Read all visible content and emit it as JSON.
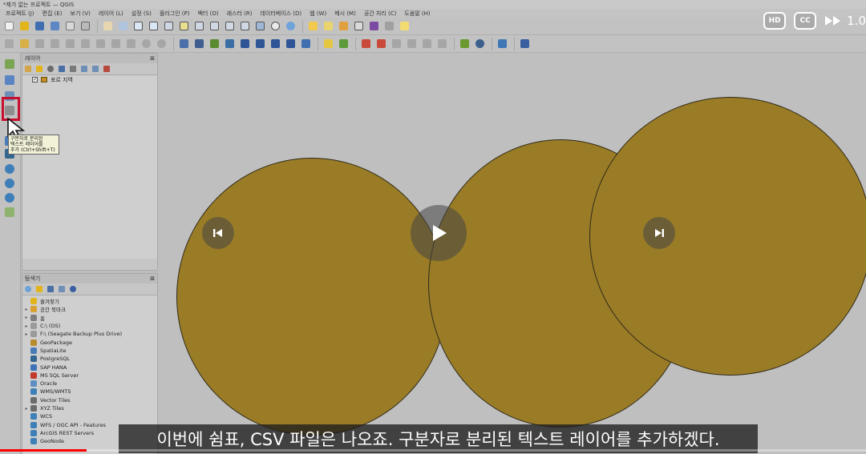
{
  "window": {
    "title": "*제가 없는 프로젝트 — QGIS"
  },
  "menu": [
    "프로젝트 (J)",
    "편집 (E)",
    "보기 (V)",
    "레이어 (L)",
    "설정 (S)",
    "플러그인 (P)",
    "벡터 (O)",
    "래스터 (R)",
    "데이터베이스 (D)",
    "웹 (W)",
    "메시 (M)",
    "공간 처리 (C)",
    "도움말 (H)"
  ],
  "layers_panel": {
    "title": "레이어",
    "layer_name": "포르 지역",
    "layer_checked": "✓",
    "layer_color": "#c48f26"
  },
  "browser_panel": {
    "title": "탐색기",
    "items": [
      {
        "label": "즐겨찾기",
        "expander": "",
        "icon_color": "#e3b51d"
      },
      {
        "label": "공간 북마크",
        "expander": "▸",
        "icon_color": "#d9a032"
      },
      {
        "label": "홈",
        "expander": "▸",
        "icon_color": "#7d7d7d"
      },
      {
        "label": "C:\\ (OS)",
        "expander": "▸",
        "icon_color": "#9a9a9a"
      },
      {
        "label": "F:\\ (Seagate Backup Plus Drive)",
        "expander": "▸",
        "icon_color": "#9a9a9a"
      },
      {
        "label": "GeoPackage",
        "expander": "",
        "icon_color": "#b88b2e"
      },
      {
        "label": "SpatiaLite",
        "expander": "",
        "icon_color": "#4a7bb7"
      },
      {
        "label": "PostgreSQL",
        "expander": "",
        "icon_color": "#336791"
      },
      {
        "label": "SAP HANA",
        "expander": "",
        "icon_color": "#3d72b8"
      },
      {
        "label": "MS SQL Server",
        "expander": "",
        "icon_color": "#c0392b"
      },
      {
        "label": "Oracle",
        "expander": "",
        "icon_color": "#5f8fc1"
      },
      {
        "label": "WMS/WMTS",
        "expander": "",
        "icon_color": "#3f7fb8"
      },
      {
        "label": "Vector Tiles",
        "expander": "",
        "icon_color": "#6b6b6b"
      },
      {
        "label": "XYZ Tiles",
        "expander": "▸",
        "icon_color": "#6b6b6b"
      },
      {
        "label": "WCS",
        "expander": "",
        "icon_color": "#3f7fb8"
      },
      {
        "label": "WFS / OGC API - Features",
        "expander": "",
        "icon_color": "#3f7fb8"
      },
      {
        "label": "ArcGIS REST Servers",
        "expander": "",
        "icon_color": "#3f7fb8"
      },
      {
        "label": "GeoNode",
        "expander": "",
        "icon_color": "#3f7fb8"
      }
    ]
  },
  "tooltip": {
    "line1": "구분자로 분리된",
    "line2": "텍스트 레이어를",
    "line3": "추가 (Ctrl+Shift+T)"
  },
  "map": {
    "fill_color": "#9a7c27",
    "stroke_color": "#2f2a18"
  },
  "video": {
    "subtitle": "이번에 쉼표, CSV 파일은 나오죠. 구분자로 분리된 텍스트 레이어를 추가하겠다.",
    "hd_badge": "HD",
    "cc_badge": "CC",
    "speed": "1.0",
    "progress": 0.1,
    "prev_icon": "skip-previous-icon",
    "play_icon": "play-icon",
    "next_icon": "skip-next-icon"
  }
}
